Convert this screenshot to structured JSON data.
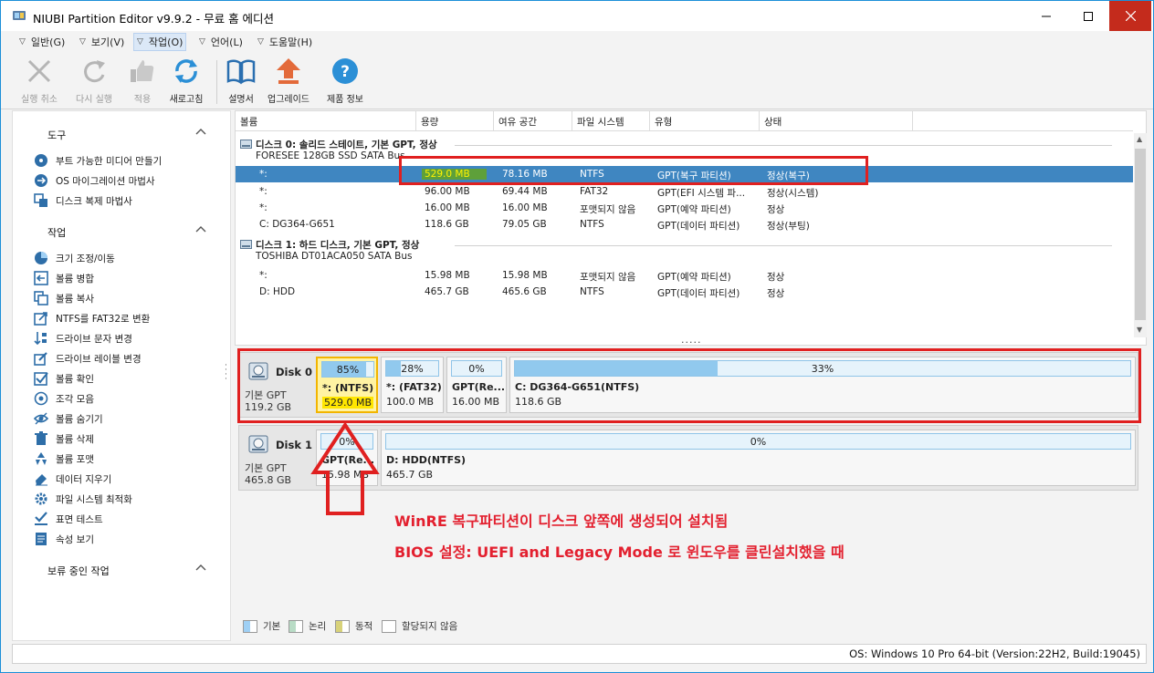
{
  "window": {
    "title": "NIUBI Partition Editor v9.9.2 - 무료 홈 에디션",
    "accent": "#1c8fd8",
    "close_color": "#c42b1c"
  },
  "menu": [
    {
      "label": "일반(G)"
    },
    {
      "label": "보기(V)"
    },
    {
      "label": "작업(O)"
    },
    {
      "label": "언어(L)"
    },
    {
      "label": "도움말(H)"
    }
  ],
  "toolbar": {
    "undo": "실행 취소",
    "redo": "다시 실행",
    "apply": "적용",
    "refresh": "새로고침",
    "manual": "설명서",
    "upgrade": "업그레이드",
    "about": "제품 정보"
  },
  "left_panel": {
    "tools_title": "도구",
    "tools": [
      "부트 가능한 미디어 만들기",
      "OS 마이그레이션 마법사",
      "디스크 복제 마법사"
    ],
    "ops_title": "작업",
    "ops": [
      "크기 조정/이동",
      "볼륨 병합",
      "볼륨 복사",
      "NTFS를 FAT32로 변환",
      "드라이브 문자 변경",
      "드라이브 레이블 변경",
      "볼륨 확인",
      "조각 모음",
      "볼륨 숨기기",
      "볼륨 삭제",
      "볼륨 포맷",
      "데이터 지우기",
      "파일 시스템 최적화",
      "표면 테스트",
      "속성 보기"
    ],
    "pending_title": "보류 중인 작업"
  },
  "table": {
    "headers": {
      "volume": "볼륨",
      "capacity": "용량",
      "free": "여유 공간",
      "fs": "파일 시스템",
      "type": "유형",
      "status": "상태"
    },
    "disk0": {
      "name": "디스크 0: 솔리드 스테이트, 기본 GPT, 정상",
      "model": "FORESEE 128GB SSD SATA Bus"
    },
    "disk0_rows": [
      {
        "vol": "*:",
        "cap": "529.0 MB",
        "free": "78.16 MB",
        "fs": "NTFS",
        "type": "GPT(복구 파티션)",
        "status": "정상(복구)"
      },
      {
        "vol": "*:",
        "cap": "96.00 MB",
        "free": "69.44 MB",
        "fs": "FAT32",
        "type": "GPT(EFI 시스템 파...",
        "status": "정상(시스템)"
      },
      {
        "vol": "*:",
        "cap": "16.00 MB",
        "free": "16.00 MB",
        "fs": "포맷되지 않음",
        "type": "GPT(예약 파티션)",
        "status": "정상"
      },
      {
        "vol": "C: DG364-G651",
        "cap": "118.6 GB",
        "free": "79.05 GB",
        "fs": "NTFS",
        "type": "GPT(데이터 파티션)",
        "status": "정상(부팅)"
      }
    ],
    "disk1": {
      "name": "디스크 1: 하드 디스크, 기본 GPT, 정상",
      "model": "TOSHIBA DT01ACA050 SATA Bus"
    },
    "disk1_rows": [
      {
        "vol": "*:",
        "cap": "15.98 MB",
        "free": "15.98 MB",
        "fs": "포맷되지 않음",
        "type": "GPT(예약 파티션)",
        "status": "정상"
      },
      {
        "vol": "D: HDD",
        "cap": "465.7 GB",
        "free": "465.6 GB",
        "fs": "NTFS",
        "type": "GPT(데이터 파티션)",
        "status": "정상"
      }
    ],
    "dots": "....."
  },
  "diskmap": {
    "disk0": {
      "name": "Disk 0",
      "type": "기본 GPT",
      "size": "119.2 GB",
      "parts": [
        {
          "pct": "85%",
          "fill": 0.85,
          "name": "*: (NTFS)",
          "size": "529.0 MB"
        },
        {
          "pct": "28%",
          "fill": 0.28,
          "name": "*: (FAT32)",
          "size": "100.0 MB"
        },
        {
          "pct": "0%",
          "fill": 0.0,
          "name": "GPT(Re...",
          "size": "16.00 MB"
        },
        {
          "pct": "33%",
          "fill": 0.33,
          "name": "C: DG364-G651(NTFS)",
          "size": "118.6 GB"
        }
      ]
    },
    "disk1": {
      "name": "Disk 1",
      "type": "기본 GPT",
      "size": "465.8 GB",
      "parts": [
        {
          "pct": "0%",
          "fill": 0.0,
          "name": "GPT(Re...",
          "size": "15.98 MB"
        },
        {
          "pct": "0%",
          "fill": 0.0,
          "name": "D: HDD(NTFS)",
          "size": "465.7 GB"
        }
      ]
    }
  },
  "annotation": {
    "line1": "WinRE 복구파티션이 디스크 앞쪽에 생성되어 설치됨",
    "line2": "BIOS 설정: UEFI and Legacy Mode 로 윈도우를 클린설치했을 때",
    "color": "#e3202f"
  },
  "legend": [
    "기본",
    "논리",
    "동적",
    "할당되지 않음"
  ],
  "status": "OS: Windows 10 Pro 64-bit (Version:22H2, Build:19045)"
}
